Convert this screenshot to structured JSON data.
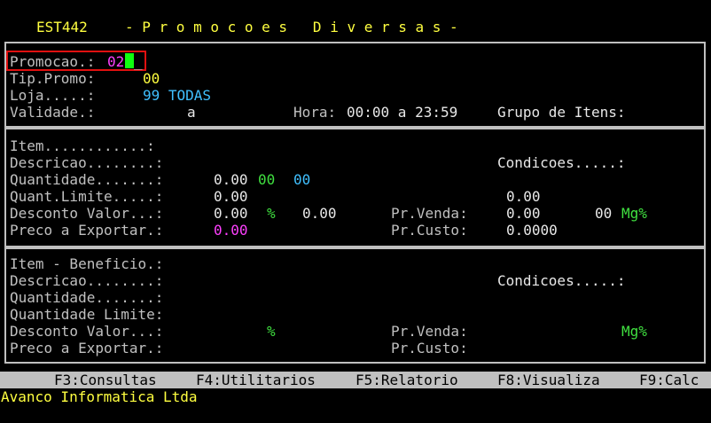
{
  "header": {
    "code": "EST442",
    "title": "- P r o m o c o e s   D i v e r s a s -"
  },
  "promo": {
    "promocao_label": "Promocao.:",
    "promocao_value": "02",
    "tip_label": "Tip.Promo:",
    "tip_value": "00",
    "loja_label": "Loja.....:",
    "loja_value": "99 TODAS",
    "validade_label": "Validade.:",
    "validade_sep": "a",
    "hora_label": "Hora:",
    "hora_value": "00:00 a 23:59",
    "grupo_label": "Grupo de Itens:"
  },
  "item": {
    "item_label": "Item............:",
    "descricao_label": "Descricao........:",
    "condicoes_label": "Condicoes.....:",
    "quantidade_label": "Quantidade.......:",
    "quantidade_value": "0.00",
    "quantidade_a": "00",
    "quantidade_b": "00",
    "quant_limite_label": "Quant.Limite.....:",
    "quant_limite_value": "0.00",
    "quant_limite_right": "0.00",
    "desconto_label": "Desconto Valor...:",
    "desconto_value": "0.00",
    "desconto_pct": "%",
    "desconto_pct_value": "0.00",
    "prvenda_label": "Pr.Venda:",
    "prvenda_value": "0.00",
    "mg_value": "00",
    "mg_label": "Mg%",
    "preco_exp_label": "Preco a Exportar.:",
    "preco_exp_value": "0.00",
    "prcusto_label": "Pr.Custo:",
    "prcusto_value": "0.0000"
  },
  "beneficio": {
    "item_label": "Item - Beneficio.:",
    "descricao_label": "Descricao........:",
    "condicoes_label": "Condicoes.....:",
    "quantidade_label": "Quantidade.......:",
    "quant_limite_label": "Quantidade Limite:",
    "desconto_label": "Desconto Valor...:",
    "desconto_pct": "%",
    "prvenda_label": "Pr.Venda:",
    "mg_label": "Mg%",
    "preco_exp_label": "Preco a Exportar.:",
    "prcusto_label": "Pr.Custo:"
  },
  "fkeys": [
    "F3:Consultas",
    "F4:Utilitarios",
    "F5:Relatorio",
    "F8:Visualiza",
    "F9:Calc"
  ],
  "footer": "Avanco Informatica Ltda"
}
